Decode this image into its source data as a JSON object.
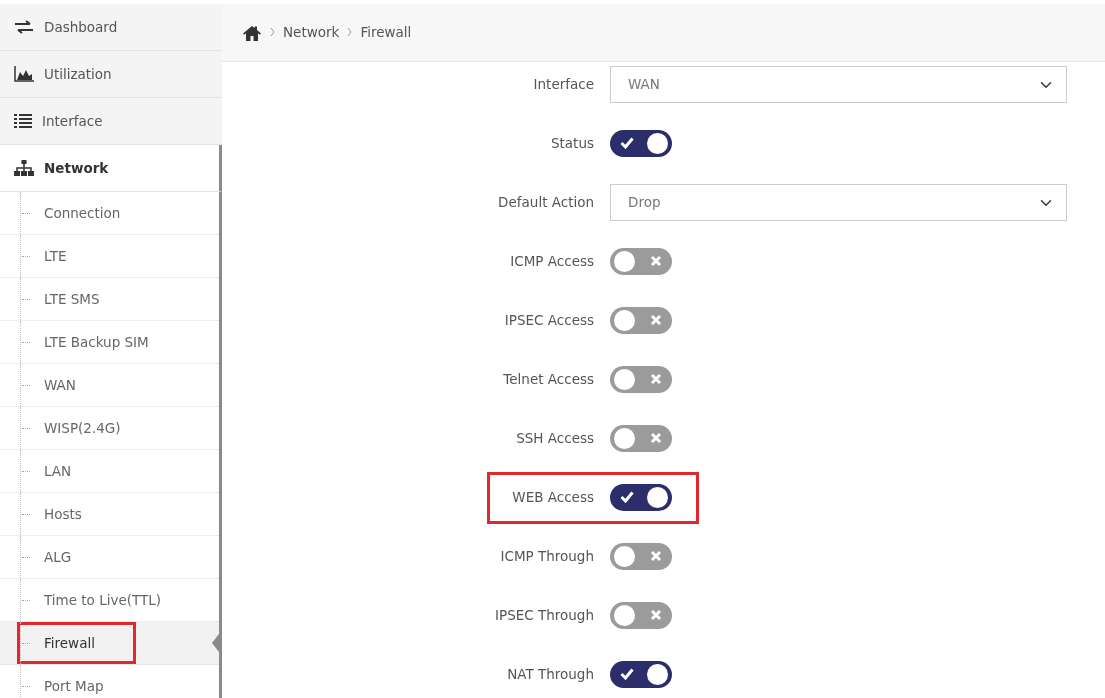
{
  "sidebar": {
    "items": [
      {
        "label": "Dashboard",
        "expanded": false
      },
      {
        "label": "Utilization",
        "expanded": false
      },
      {
        "label": "Interface",
        "expanded": false
      },
      {
        "label": "Network",
        "expanded": true,
        "children": [
          {
            "label": "Connection",
            "selected": false,
            "highlighted": false
          },
          {
            "label": "LTE",
            "selected": false,
            "highlighted": false
          },
          {
            "label": "LTE SMS",
            "selected": false,
            "highlighted": false
          },
          {
            "label": "LTE Backup SIM",
            "selected": false,
            "highlighted": false
          },
          {
            "label": "WAN",
            "selected": false,
            "highlighted": false
          },
          {
            "label": "WISP(2.4G)",
            "selected": false,
            "highlighted": false
          },
          {
            "label": "LAN",
            "selected": false,
            "highlighted": false
          },
          {
            "label": "Hosts",
            "selected": false,
            "highlighted": false
          },
          {
            "label": "ALG",
            "selected": false,
            "highlighted": false
          },
          {
            "label": "Time to Live(TTL)",
            "selected": false,
            "highlighted": false
          },
          {
            "label": "Firewall",
            "selected": true,
            "highlighted": true
          },
          {
            "label": "Port Map",
            "selected": false,
            "highlighted": false
          }
        ]
      }
    ]
  },
  "breadcrumb": [
    "Network",
    "Firewall"
  ],
  "form": [
    {
      "kind": "select",
      "label": "Interface",
      "value": "WAN"
    },
    {
      "kind": "toggle",
      "label": "Status",
      "on": true,
      "highlighted": false
    },
    {
      "kind": "select",
      "label": "Default Action",
      "value": "Drop"
    },
    {
      "kind": "toggle",
      "label": "ICMP Access",
      "on": false,
      "highlighted": false
    },
    {
      "kind": "toggle",
      "label": "IPSEC Access",
      "on": false,
      "highlighted": false
    },
    {
      "kind": "toggle",
      "label": "Telnet Access",
      "on": false,
      "highlighted": false
    },
    {
      "kind": "toggle",
      "label": "SSH Access",
      "on": false,
      "highlighted": false
    },
    {
      "kind": "toggle",
      "label": "WEB Access",
      "on": true,
      "highlighted": true
    },
    {
      "kind": "toggle",
      "label": "ICMP Through",
      "on": false,
      "highlighted": false
    },
    {
      "kind": "toggle",
      "label": "IPSEC Through",
      "on": false,
      "highlighted": false
    },
    {
      "kind": "toggle",
      "label": "NAT Through",
      "on": true,
      "highlighted": false
    }
  ]
}
